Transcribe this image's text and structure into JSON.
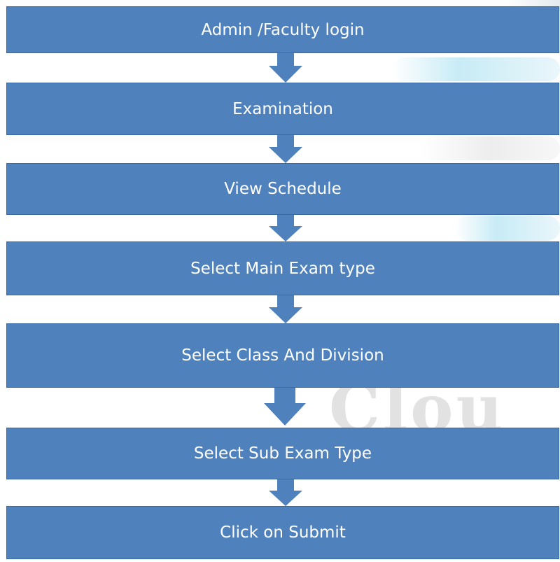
{
  "flowchart": {
    "steps": [
      {
        "label": "Admin /Faculty login"
      },
      {
        "label": "Examination"
      },
      {
        "label": "View Schedule"
      },
      {
        "label": "Select Main Exam type"
      },
      {
        "label": "Select Class And Division"
      },
      {
        "label": "Select Sub Exam Type"
      },
      {
        "label": "Click on Submit"
      }
    ],
    "colors": {
      "box_fill": "#4f81bd",
      "box_text": "#ffffff",
      "arrow_fill": "#4f81bd"
    },
    "arrow_icon": "down-arrow-icon"
  }
}
